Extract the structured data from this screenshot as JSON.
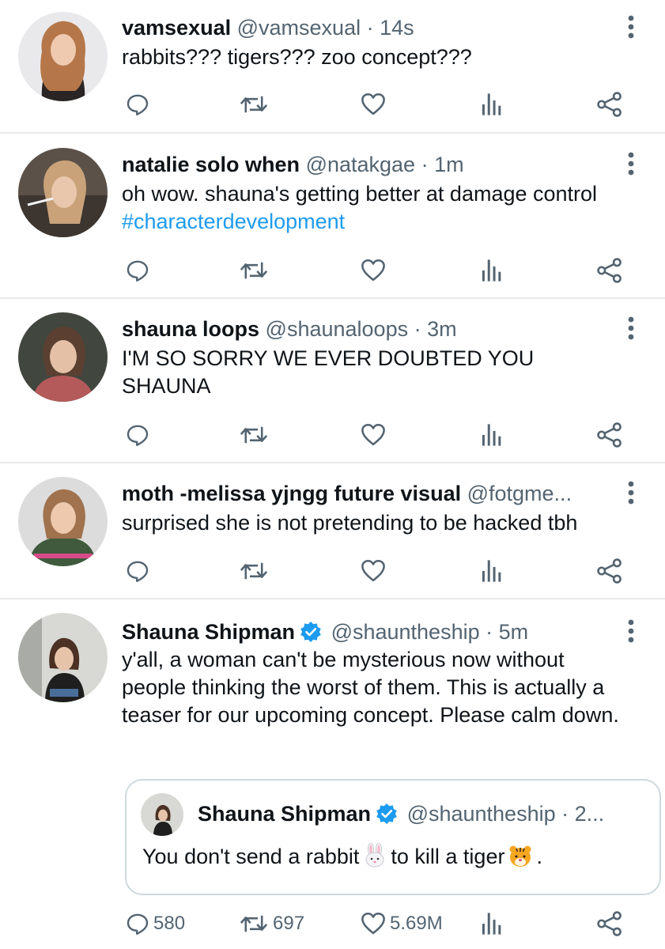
{
  "tweets": [
    {
      "name": "vamsexual",
      "handle": "@vamsexual",
      "time": "· 14s",
      "text": "rabbits??? tigers??? zoo concept???"
    },
    {
      "name": "natalie solo when",
      "handle": "@natakgae",
      "time": "· 1m",
      "text": "oh wow. shauna's getting better at damage control ",
      "hashtag": "#characterdevelopment"
    },
    {
      "name": "shauna loops",
      "handle": "@shaunaloops",
      "time": "· 3m",
      "text": "I'M SO SORRY WE EVER DOUBTED YOU SHAUNA"
    },
    {
      "name": "moth -melissa yjngg future visual",
      "handle": "@fotgme...",
      "time": "",
      "text": "surprised she is not pretending to be hacked tbh"
    },
    {
      "name": "Shauna Shipman",
      "handle": "@shauntheship",
      "time": "· 5m",
      "text": "y'all, a woman can't be mysterious now without people thinking the worst of them. This is actually a teaser for our upcoming concept. Please calm down.",
      "quote": {
        "name": "Shauna Shipman",
        "handle": "@shauntheship",
        "time": "· 2...",
        "text_before": "You don't send a rabbit",
        "text_middle": "to kill a tiger",
        "text_after": "."
      },
      "counts": {
        "replies": "580",
        "retweets": "697",
        "likes": "5.69M"
      }
    }
  ],
  "icons": {
    "reply": "reply-icon",
    "retweet": "retweet-icon",
    "like": "heart-icon",
    "analytics": "analytics-icon",
    "share": "share-icon",
    "more": "more-icon",
    "verified": "verified-badge-icon"
  },
  "colors": {
    "text": "#0f1419",
    "secondary": "#536471",
    "hashtag": "#1d9bf0",
    "verified": "#1d9bf0",
    "divider": "#e7e9ea"
  }
}
